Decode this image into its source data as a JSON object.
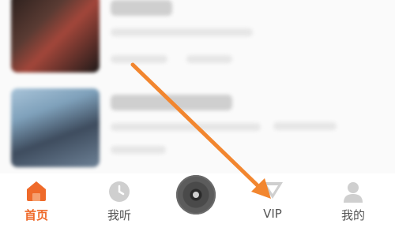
{
  "tabbar": {
    "tabs": [
      {
        "label": "首页",
        "icon": "home-icon",
        "active": true
      },
      {
        "label": "我听",
        "icon": "clock-icon",
        "active": false
      },
      {
        "label": "",
        "icon": "play-disc-icon",
        "active": false
      },
      {
        "label": "VIP",
        "icon": "vip-icon",
        "active": false
      },
      {
        "label": "我的",
        "icon": "user-icon",
        "active": false
      }
    ]
  },
  "colors": {
    "accent": "#ef6a2a",
    "arrow": "#f2862f",
    "inactive": "#555555"
  }
}
